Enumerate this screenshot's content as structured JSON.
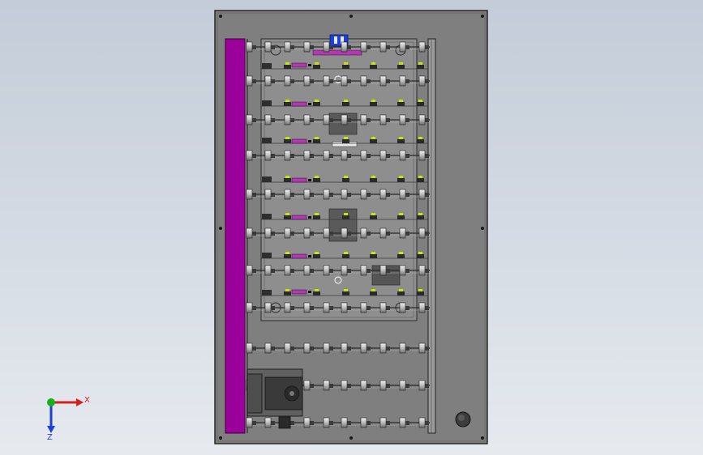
{
  "viewport": {
    "background_top": "#c3ccd8",
    "background_bottom": "#e6eaef"
  },
  "colors": {
    "plate": "#7f7f7f",
    "plate_edge": "#1e1e1e",
    "side_bar": "#9b009b",
    "roller": "#d9d9d9",
    "part_dark": "#444444",
    "sensor": "#c8e600",
    "tag": "#b03ab0",
    "connector_blue": "#1e3fd8",
    "axis_x": "#d62020",
    "axis_y": "#18b018",
    "axis_z": "#1e3fd8"
  },
  "triad": {
    "x_label": "X",
    "z_label": "Z"
  }
}
